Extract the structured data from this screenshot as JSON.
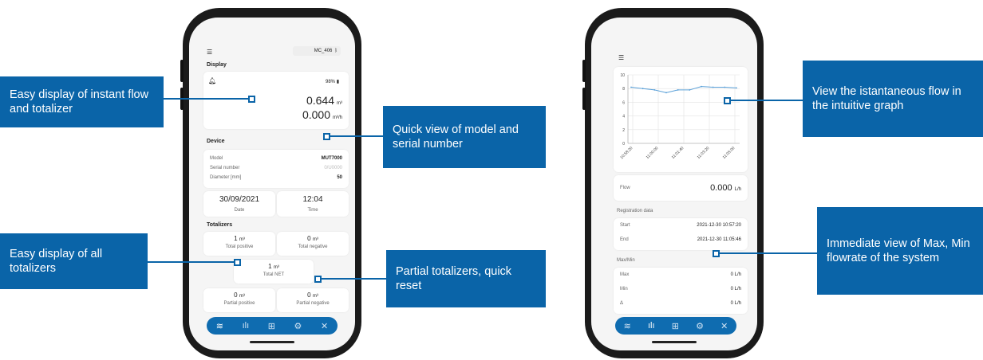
{
  "callouts": {
    "instant_flow": "Easy display of instant flow and totalizer",
    "model_serial": "Quick view of model and serial number",
    "all_totalizers": "Easy display of all totalizers",
    "partial_totalizers": "Partial totalizers, quick reset",
    "graph": "View the istantaneous flow in the intuitive graph",
    "maxmin": "Immediate view of Max, Min flowrate of the system"
  },
  "phone1": {
    "device_id": "MC_406",
    "display_title": "Display",
    "battery": "98%",
    "volume_value": "0.644",
    "volume_unit": "m³",
    "flow_value": "0.000",
    "flow_unit": "m³/h",
    "device_title": "Device",
    "model_label": "Model",
    "model_value": "MUT7000",
    "serial_label": "Serial number",
    "serial_value": "0/U0000",
    "diameter_label": "Diameter [mm]",
    "diameter_value": "50",
    "date_value": "30/09/2021",
    "date_label": "Date",
    "time_value": "12:04",
    "time_label": "Time",
    "totalizers_title": "Totalizers",
    "total_positive_value": "1",
    "total_positive_unit": "m³",
    "total_positive_label": "Total positive",
    "total_negative_value": "0",
    "total_negative_unit": "m³",
    "total_negative_label": "Total negative",
    "total_net_value": "1",
    "total_net_unit": "m³",
    "total_net_label": "Total NET",
    "partial_positive_value": "0",
    "partial_positive_unit": "m³",
    "partial_positive_label": "Partial positive",
    "partial_negative_value": "0",
    "partial_negative_unit": "m³",
    "partial_negative_label": "Partial negative"
  },
  "phone2": {
    "chart_data": {
      "type": "line",
      "x": [
        "10:58:20",
        "11:00:00",
        "11:01:40",
        "11:03:20",
        "11:05:00"
      ],
      "series": [
        {
          "values": [
            8.2,
            8.0,
            7.8,
            7.4,
            7.8,
            7.8,
            8.3,
            8.2,
            8.2,
            8.1
          ]
        }
      ],
      "ylim": [
        0,
        10
      ],
      "yticks": [
        "10",
        "8",
        "6",
        "4",
        "2",
        "0"
      ],
      "grid": true
    },
    "flow_label": "Flow",
    "flow_value": "0.000",
    "flow_unit": "L/h",
    "registration_title": "Registration data",
    "start_label": "Start",
    "start_value": "2021-12-30 10:57:20",
    "end_label": "End",
    "end_value": "2021-12-30 11:05:46",
    "maxmin_title": "Max/Min",
    "max_label": "Max",
    "max_value": "0 L/h",
    "min_label": "Min",
    "min_value": "0 L/h",
    "delta_label": "Δ",
    "delta_value": "0 L/h"
  },
  "icons": [
    "menu-icon",
    "bluetooth-icon",
    "bell-icon",
    "battery-icon",
    "layers-icon",
    "bar-chart-icon",
    "grid-icon",
    "gear-icon",
    "tools-icon"
  ]
}
